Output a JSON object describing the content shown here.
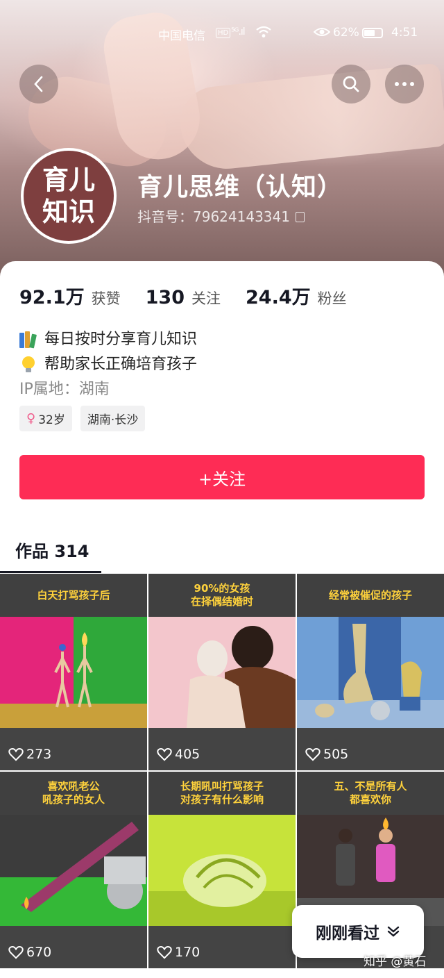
{
  "status_bar": {
    "carrier": "中国电信",
    "hd": "HD",
    "signal": "⁵ᴳ.ıl",
    "battery_pct": "62%",
    "battery_level": 0.62,
    "time": "4:51"
  },
  "profile": {
    "avatar_text_line1": "育儿",
    "avatar_text_line2": "知识",
    "name": "育儿思维（认知）",
    "douyin_id": "抖音号：79624143341"
  },
  "stats": [
    {
      "num": "92.1万",
      "label": "获赞"
    },
    {
      "num": "130",
      "label": "关注"
    },
    {
      "num": "24.4万",
      "label": "粉丝"
    }
  ],
  "bio": {
    "line1": "每日按时分享育儿知识",
    "line2": "帮助家长正确培育孩子",
    "ip": "IP属地：湖南"
  },
  "tags": {
    "age": "32岁",
    "location": "湖南·长沙"
  },
  "follow_button": "+关注",
  "works_tab": "作品 314",
  "videos": [
    {
      "title": "白天打骂孩子后",
      "likes": "273"
    },
    {
      "title": "90%的女孩\n在择偶结婚时",
      "likes": "405"
    },
    {
      "title": "经常被催促的孩子",
      "likes": "505"
    },
    {
      "title": "喜欢吼老公\n吼孩子的女人",
      "likes": "670"
    },
    {
      "title": "长期吼叫打骂孩子\n对孩子有什么影响",
      "likes": "170"
    },
    {
      "title": "五、不是所有人\n都喜欢你",
      "likes": ""
    }
  ],
  "recent_pill": "刚刚看过",
  "watermark": "知乎 @黄石",
  "colors": {
    "accent": "#fe2c55",
    "avatar_bg": "#7e3f3f",
    "tile_title": "#ffd23c"
  }
}
